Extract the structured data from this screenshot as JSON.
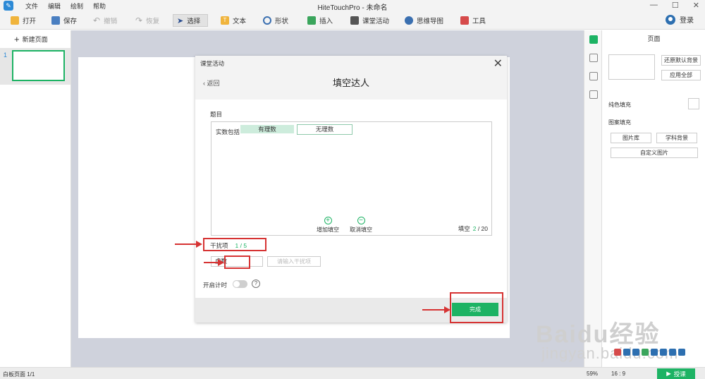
{
  "app": {
    "title": "HiteTouchPro - 未命名",
    "menu": [
      "文件",
      "编辑",
      "绘制",
      "帮助"
    ],
    "window_controls": [
      "—",
      "☐",
      "✕"
    ]
  },
  "toolbar": {
    "open": "打开",
    "save": "保存",
    "undo": "撤销",
    "redo": "恢复",
    "select": "选择",
    "text": "文本",
    "shape": "形状",
    "insert": "插入",
    "class_activity": "课堂活动",
    "mindmap": "思维导图",
    "tools": "工具",
    "login": "登录"
  },
  "left_pane": {
    "new_page": "新建页面",
    "pages": [
      {
        "number": "1"
      }
    ]
  },
  "right_panel": {
    "title": "页面",
    "restore_bg": "还原默认背景",
    "apply_all": "应用全部",
    "solid_fill": "纯色填充",
    "pattern_fill": "图案填充",
    "gallery": "图片库",
    "subject_bg": "学科背景",
    "custom_image": "自定义图片"
  },
  "dialog": {
    "header_small": "课堂活动",
    "back": "返回",
    "title": "填空达人",
    "question_label": "题目",
    "question_prefix": "实数包括",
    "blanks": [
      "有理数",
      "无理数"
    ],
    "add_blank": "增加填空",
    "remove_blank": "取消填空",
    "fill_label": "填空",
    "fill_current": "2",
    "fill_total": "/ 20",
    "distractor_label": "干扰项",
    "distractor_count": "1 / 5",
    "distractor_value": "虚数",
    "distractor_placeholder": "请输入干扰项",
    "timer_label": "开启计时",
    "help": "?",
    "done": "完成"
  },
  "status": {
    "page_info": "白板页面 1/1",
    "zoom": "59%",
    "ratio": "16 : 9",
    "start": "授课"
  },
  "watermark": {
    "brand": "Baidu经验",
    "url": "jingyan.baidu.com"
  },
  "colors": {
    "accent": "#1db364",
    "canvas_bg": "#cfd2dc",
    "annotation": "#d63333",
    "blank_fill": "#cdecdc"
  }
}
